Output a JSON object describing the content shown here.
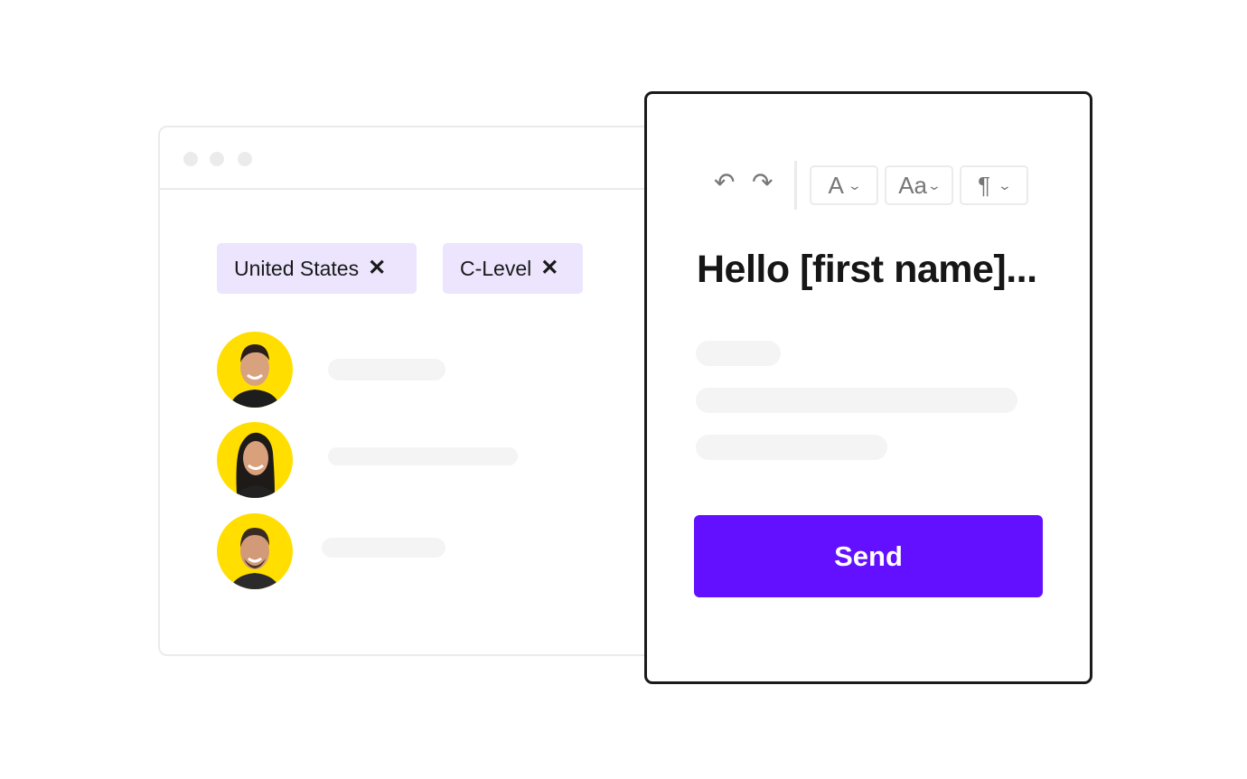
{
  "contacts_window": {
    "window_controls": [
      "dot",
      "dot",
      "dot"
    ],
    "filters": [
      {
        "label": "United States",
        "remove_icon": "✕"
      },
      {
        "label": "C-Level",
        "remove_icon": "✕"
      }
    ],
    "contacts": [
      {
        "avatar": "avatar-man-short-hair",
        "name_placeholder": ""
      },
      {
        "avatar": "avatar-woman-long-hair",
        "name_placeholder": ""
      },
      {
        "avatar": "avatar-man-bald",
        "name_placeholder": ""
      }
    ]
  },
  "editor": {
    "toolbar": {
      "undo_icon": "↶",
      "redo_icon": "↷",
      "font_color_label": "A",
      "font_size_label": "Aa",
      "paragraph_label": "¶",
      "chevron": "⌄"
    },
    "heading": "Hello [first name]...",
    "send_label": "Send"
  },
  "colors": {
    "accent": "#6210ff",
    "chip_bg": "#ece5fd",
    "avatar_bg": "#ffde00",
    "placeholder_bar": "#f4f4f4",
    "border_light": "#ebebeb",
    "border_dark": "#1a1a1a"
  }
}
